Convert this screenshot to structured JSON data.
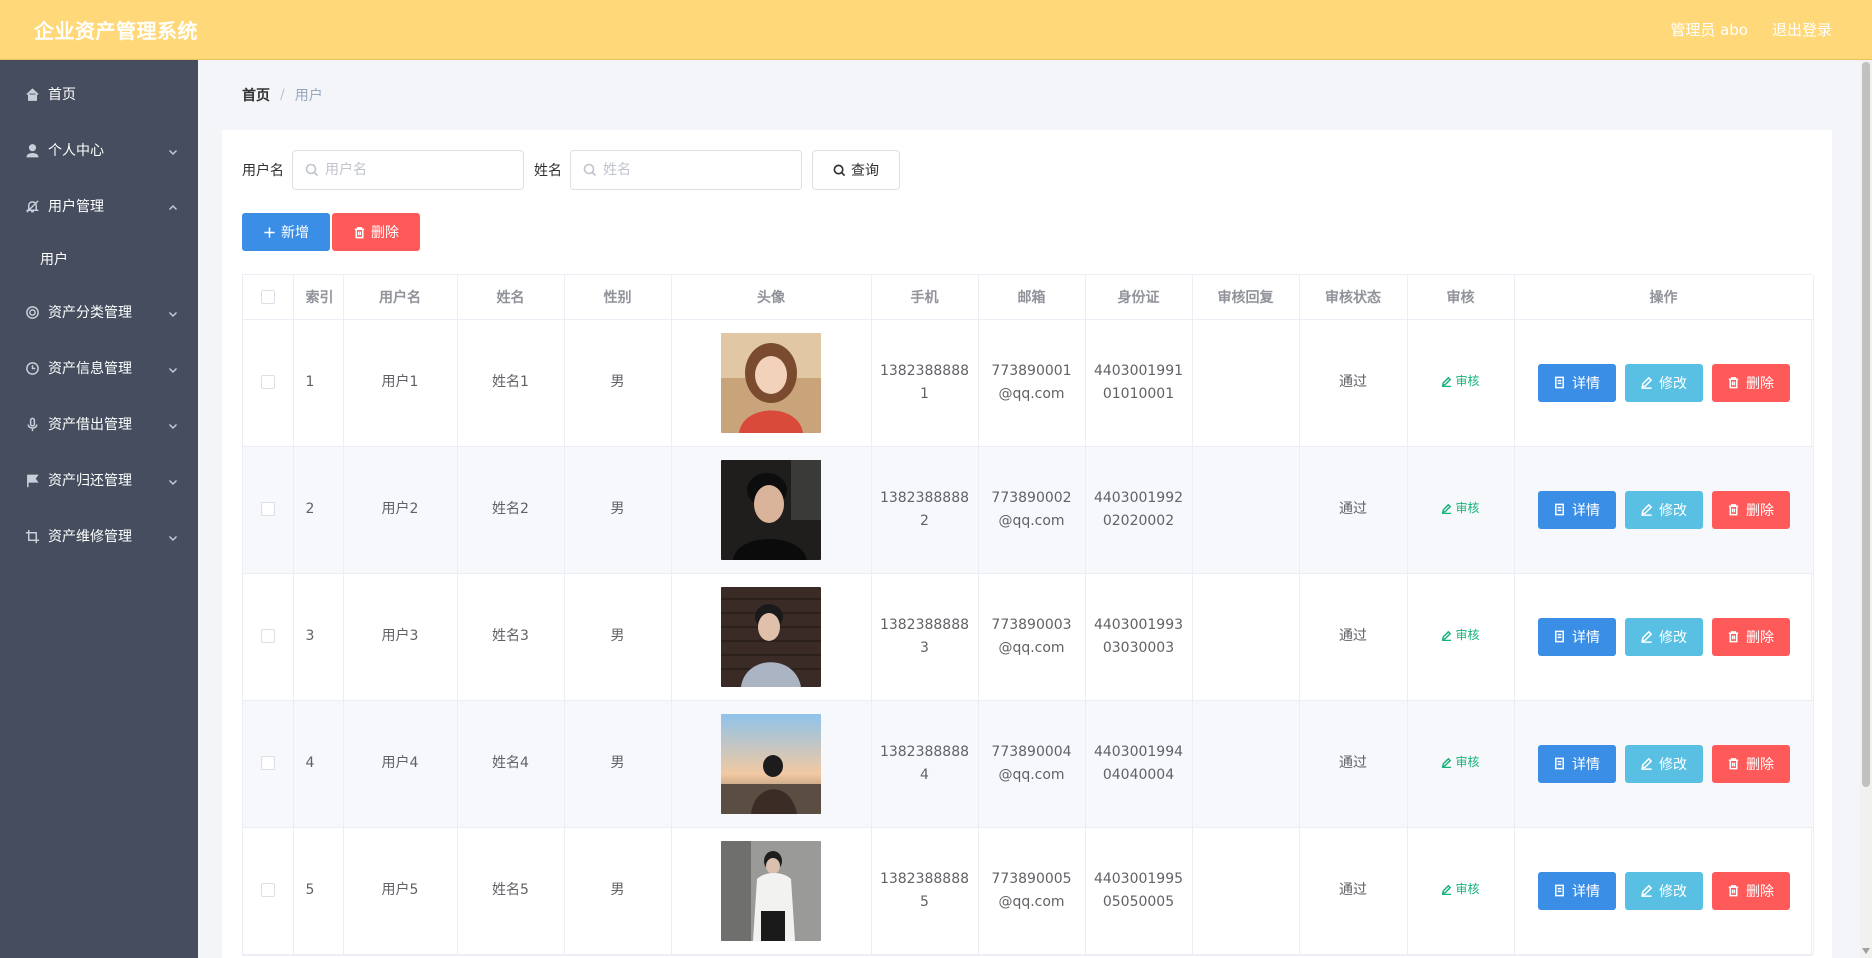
{
  "header": {
    "app_title": "企业资产管理系统",
    "admin_label": "管理员 abo",
    "logout_label": "退出登录"
  },
  "sidebar": {
    "items": [
      {
        "label": "首页",
        "icon": "home-icon",
        "expandable": false
      },
      {
        "label": "个人中心",
        "icon": "user-icon",
        "expandable": true,
        "expanded": false
      },
      {
        "label": "用户管理",
        "icon": "bell-off-icon",
        "expandable": true,
        "expanded": true
      },
      {
        "label": "资产分类管理",
        "icon": "lifebuoy-icon",
        "expandable": true,
        "expanded": false
      },
      {
        "label": "资产信息管理",
        "icon": "clock-icon",
        "expandable": true,
        "expanded": false
      },
      {
        "label": "资产借出管理",
        "icon": "microphone-icon",
        "expandable": true,
        "expanded": false
      },
      {
        "label": "资产归还管理",
        "icon": "flag-icon",
        "expandable": true,
        "expanded": false
      },
      {
        "label": "资产维修管理",
        "icon": "crop-icon",
        "expandable": true,
        "expanded": false
      }
    ],
    "submenu_user": "用户"
  },
  "breadcrumb": {
    "home": "首页",
    "separator": "/",
    "current": "用户"
  },
  "search": {
    "username_label": "用户名",
    "username_placeholder": "用户名",
    "name_label": "姓名",
    "name_placeholder": "姓名",
    "query_label": "查询"
  },
  "actions": {
    "add_label": "新增",
    "delete_label": "删除"
  },
  "table": {
    "headers": [
      "",
      "索引",
      "用户名",
      "姓名",
      "性别",
      "头像",
      "手机",
      "邮箱",
      "身份证",
      "审核回复",
      "审核状态",
      "审核",
      "操作"
    ],
    "audit_link": "审核",
    "detail_label": "详情",
    "edit_label": "修改",
    "delete_label": "删除",
    "rows": [
      {
        "index": "1",
        "username": "用户1",
        "name": "姓名1",
        "gender": "男",
        "avatar": "photo-girl-red-shirt",
        "phone": "13823888881",
        "email": "773890001@qq.com",
        "id_card": "440300199101010001",
        "audit_reply": "",
        "audit_status": "通过"
      },
      {
        "index": "2",
        "username": "用户2",
        "name": "姓名2",
        "gender": "男",
        "avatar": "photo-boy-dark",
        "phone": "13823888882",
        "email": "773890002@qq.com",
        "id_card": "440300199202020002",
        "audit_reply": "",
        "audit_status": "通过"
      },
      {
        "index": "3",
        "username": "用户3",
        "name": "姓名3",
        "gender": "男",
        "avatar": "photo-boy-brick-wall",
        "phone": "13823888883",
        "email": "773890003@qq.com",
        "id_card": "440300199303030003",
        "audit_reply": "",
        "audit_status": "通过"
      },
      {
        "index": "4",
        "username": "用户4",
        "name": "姓名4",
        "gender": "男",
        "avatar": "photo-boy-sunset",
        "phone": "13823888884",
        "email": "773890004@qq.com",
        "id_card": "440300199404040004",
        "audit_reply": "",
        "audit_status": "通过"
      },
      {
        "index": "5",
        "username": "用户5",
        "name": "姓名5",
        "gender": "男",
        "avatar": "photo-boy-white-jacket",
        "phone": "13823888885",
        "email": "773890005@qq.com",
        "id_card": "440300199505050005",
        "audit_reply": "",
        "audit_status": "通过"
      }
    ]
  },
  "colors": {
    "header_bg": "#ffd879",
    "sidebar_bg": "#454d5e",
    "primary": "#3a8ee6",
    "info": "#59bfe3",
    "danger": "#ff5a5a",
    "success_text": "#17b37a"
  }
}
